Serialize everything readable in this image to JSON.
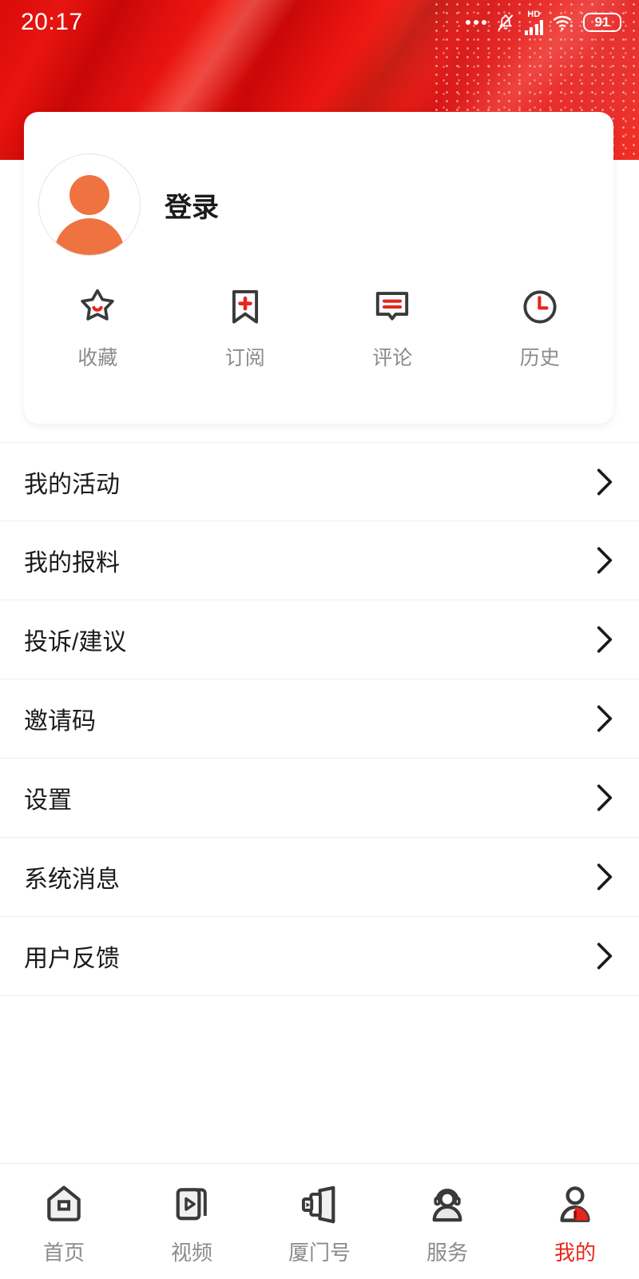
{
  "statusbar": {
    "time": "20:17",
    "hd_label": "HD",
    "battery_level": "91",
    "icons": [
      "more-dots-icon",
      "bell-muted-icon",
      "hd-signal-icon",
      "wifi-icon",
      "battery-icon"
    ]
  },
  "theme": {
    "brand_red": "#e8261c",
    "header_red": "#e01010",
    "avatar_orange": "#ef7340",
    "label_gray": "#8b8b8b",
    "text_dark": "#1a1a1a",
    "divider": "#efefef"
  },
  "profile": {
    "avatar_icon": "user-avatar-icon",
    "login_label": "登录"
  },
  "quick_actions": [
    {
      "icon": "star-icon",
      "label": "收藏"
    },
    {
      "icon": "bookmark-plus-icon",
      "label": "订阅"
    },
    {
      "icon": "comment-icon",
      "label": "评论"
    },
    {
      "icon": "clock-icon",
      "label": "历史"
    }
  ],
  "menu": {
    "chevron_icon": "chevron-right-icon",
    "items": [
      {
        "label": "我的活动"
      },
      {
        "label": "我的报料"
      },
      {
        "label": "投诉/建议"
      },
      {
        "label": "邀请码"
      },
      {
        "label": "设置"
      },
      {
        "label": "系统消息"
      },
      {
        "label": "用户反馈"
      }
    ]
  },
  "tabbar": {
    "items": [
      {
        "label": "首页",
        "icon": "home-icon",
        "active": false
      },
      {
        "label": "视频",
        "icon": "video-icon",
        "active": false
      },
      {
        "label": "厦门号",
        "icon": "channel-icon",
        "active": false
      },
      {
        "label": "服务",
        "icon": "service-icon",
        "active": false
      },
      {
        "label": "我的",
        "icon": "profile-icon",
        "active": true
      }
    ]
  }
}
